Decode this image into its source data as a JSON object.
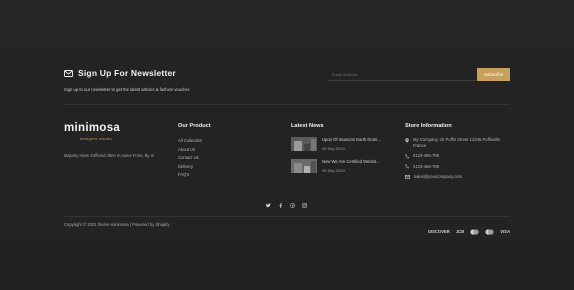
{
  "newsletter": {
    "title": "Sign Up For Newsletter",
    "subtitle": "Sign up to our newsletter to get the latest articles & fashion voucher.",
    "placeholder": "Email Address",
    "button": "Subscribe",
    "icon": "envelope-icon"
  },
  "brand": {
    "name": "minimosa",
    "tagline": "designer-studio",
    "about": "Majority Have Suffered Alten In Asme From, By In"
  },
  "our_product": {
    "title": "Our Product",
    "links": [
      "All Collection",
      "About Us",
      "Contact Us",
      "Delivery",
      "FAQ's"
    ]
  },
  "latest_news": {
    "title": "Latest News",
    "items": [
      {
        "title": "Upon Of Seasons Earth Domi...",
        "date": "05 Sep 2019"
      },
      {
        "title": "Now We Are Certified Websit...",
        "date": "05 Sep 2019"
      }
    ]
  },
  "store": {
    "title": "Store Information",
    "address": "My Company, 42 Puffin Street 12345 Puffinville France",
    "phone1": "0123-456-789",
    "phone2": "0123-456-789",
    "email": "sales@yourcompany.com"
  },
  "social": [
    "twitter-icon",
    "facebook-icon",
    "pinterest-icon",
    "instagram-icon"
  ],
  "footer": {
    "copyright": "Copyright © 2021 theme-minimosa | Powered by Shopify",
    "payments": [
      "DISCOVER",
      "JCB",
      "MC",
      "MC",
      "VISA"
    ]
  },
  "colors": {
    "accent": "#c6a15b",
    "background": "#232323"
  }
}
